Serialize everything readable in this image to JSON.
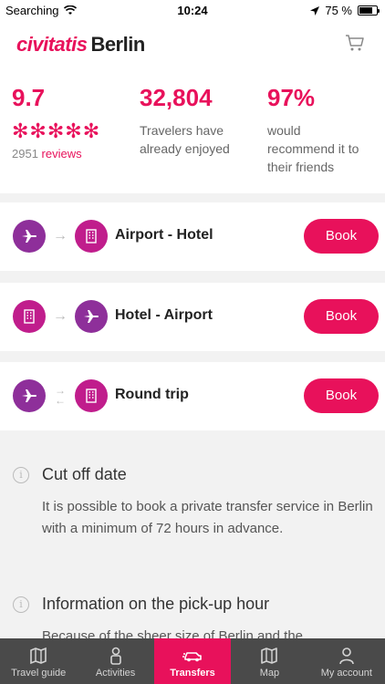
{
  "status_bar": {
    "carrier": "Searching",
    "time": "10:24",
    "battery": "75 %"
  },
  "header": {
    "logo": "civitatis",
    "city": "Berlin"
  },
  "stats": {
    "rating": "9.7",
    "stars": "✻✻✻✻✻",
    "reviews_count": "2951",
    "reviews_label": "reviews",
    "travelers": "32,804",
    "travelers_desc_1": "Travelers have",
    "travelers_desc_2": "already enjoyed",
    "recommend": "97%",
    "recommend_desc_1": "would",
    "recommend_desc_2": "recommend it to",
    "recommend_desc_3": "their friends"
  },
  "transfers": [
    {
      "label": "Airport - Hotel",
      "book_label": "Book"
    },
    {
      "label": "Hotel - Airport",
      "book_label": "Book"
    },
    {
      "label": "Round trip",
      "book_label": "Book"
    }
  ],
  "info": [
    {
      "title": "Cut off date",
      "body": "It is possible to book a private transfer service in Berlin with a minimum of 72 hours in advance."
    },
    {
      "title": "Information on the pick-up hour",
      "body": "Because of the sheer size of Berlin and the"
    }
  ],
  "tabbar": [
    {
      "label": "Travel guide",
      "icon": "book-icon",
      "active": false
    },
    {
      "label": "Activities",
      "icon": "person-icon",
      "active": false
    },
    {
      "label": "Transfers",
      "icon": "car-icon",
      "active": true
    },
    {
      "label": "Map",
      "icon": "map-icon",
      "active": false
    },
    {
      "label": "My account",
      "icon": "account-icon",
      "active": false
    }
  ],
  "colors": {
    "accent": "#e8115b",
    "purple": "#8e2f9a",
    "magenta": "#c01d8c",
    "tabbar": "#4a4a4a"
  }
}
